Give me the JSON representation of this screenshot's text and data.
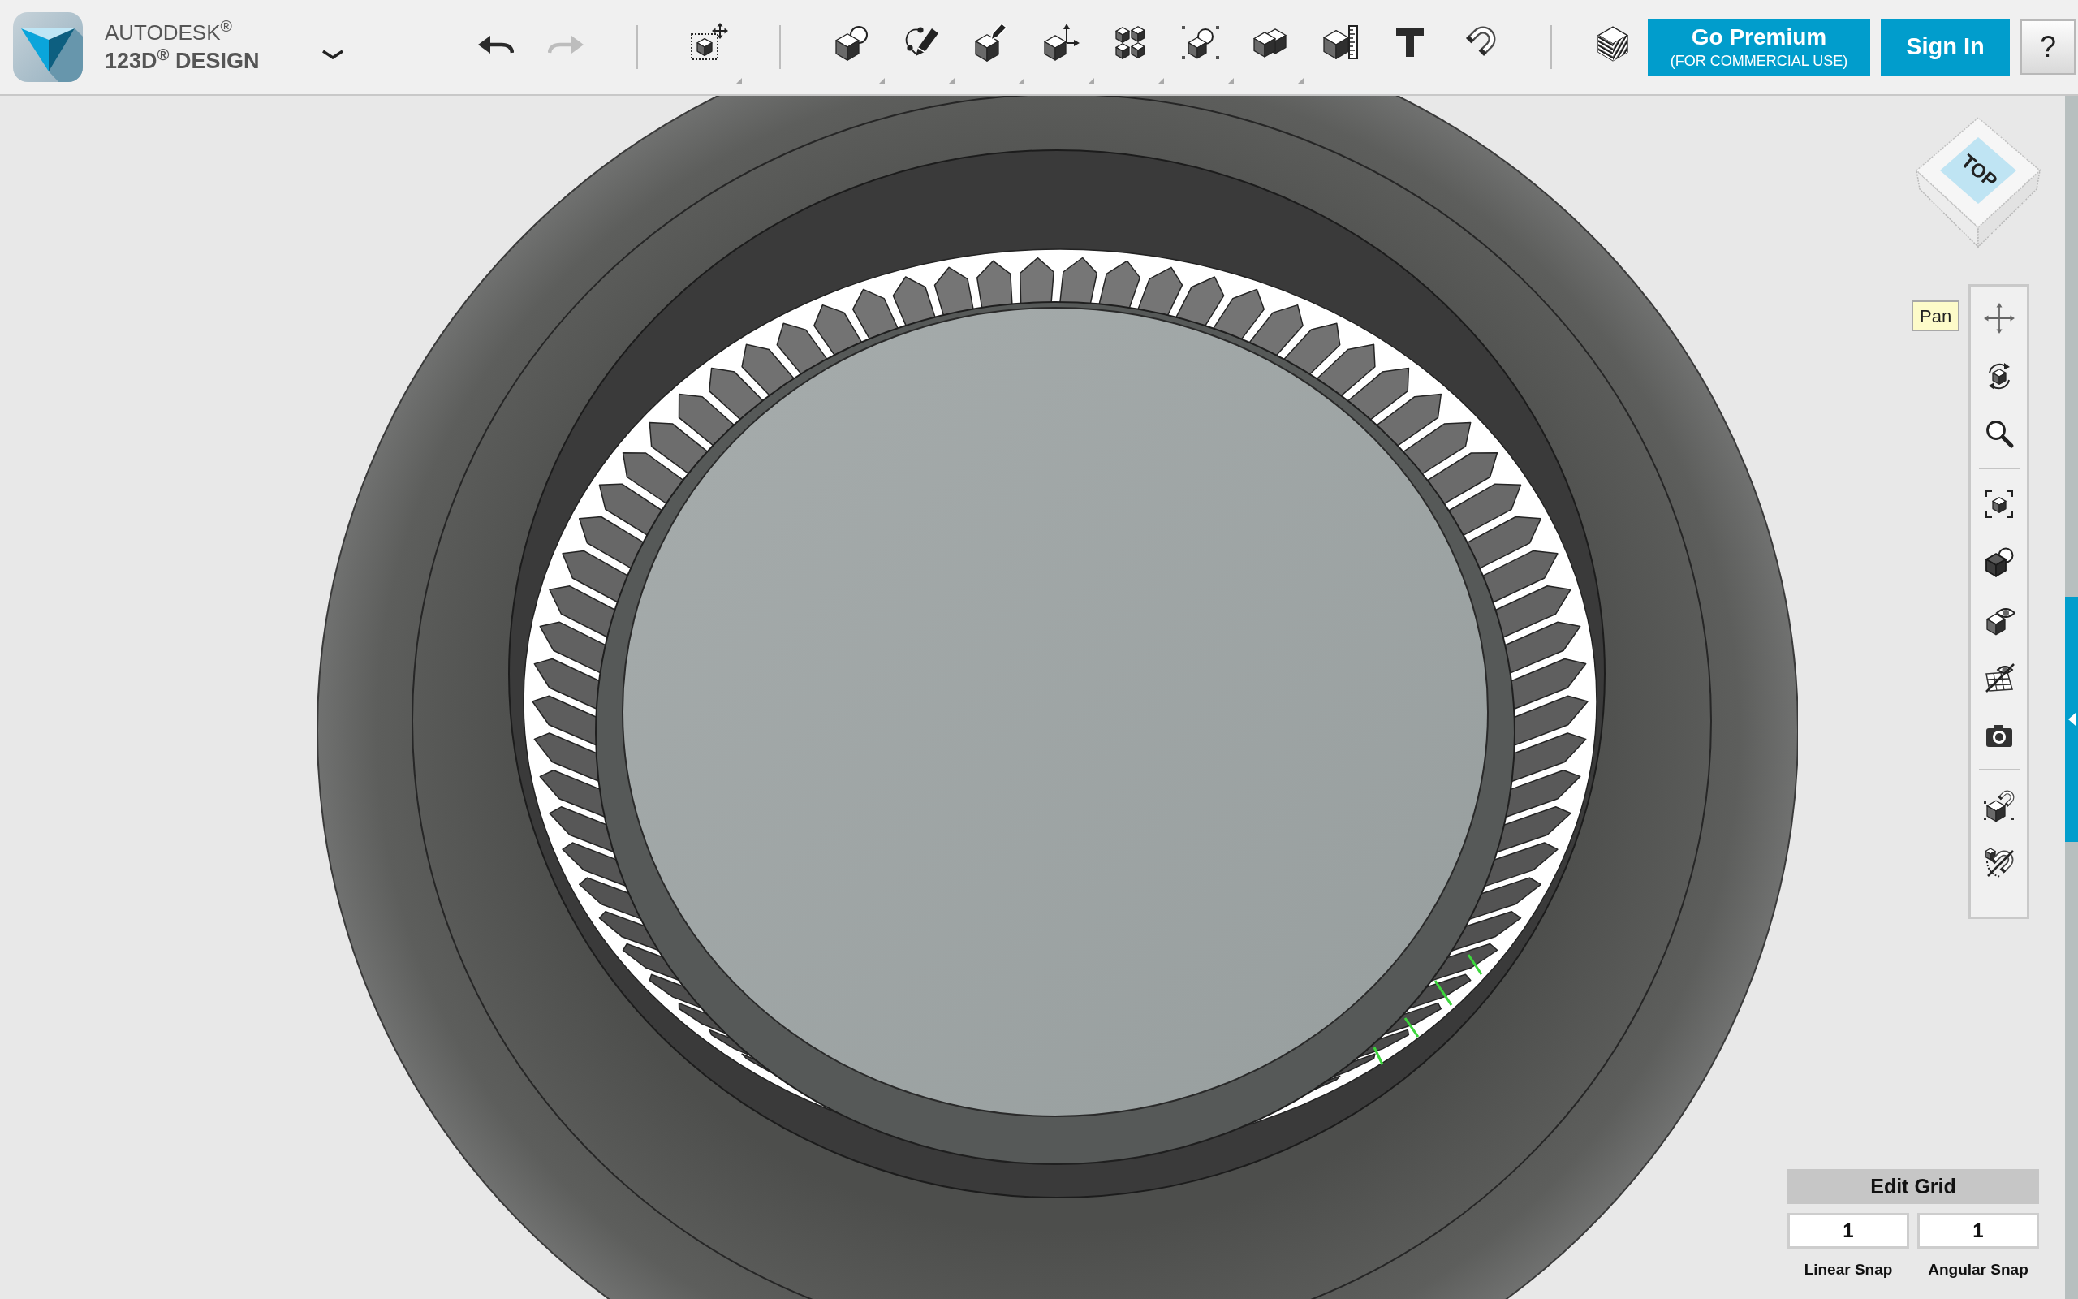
{
  "app_title": {
    "line_1": "AUTODESK$^{®}$",
    "line_2": "123D$^{®}$ DESIGN"
  },
  "history": [
    {
      "kind": "undo",
      "disabled": false
    },
    {
      "kind": "redo",
      "disabled": true
    }
  ],
  "tool_groups": [
    {
      "tools": [
        {
          "kind": "transform",
          "menu": true
        }
      ]
    },
    {
      "tools": [
        {
          "kind": "primitives",
          "menu": true
        },
        {
          "kind": "sketch",
          "menu": true
        },
        {
          "kind": "construct",
          "menu": true
        },
        {
          "kind": "modify",
          "menu": true
        },
        {
          "kind": "pattern",
          "menu": true
        },
        {
          "kind": "grouping",
          "menu": true
        },
        {
          "kind": "combine",
          "menu": true
        },
        {
          "kind": "measure",
          "menu": false
        },
        {
          "kind": "text",
          "menu": false
        },
        {
          "kind": "snap",
          "menu": false
        }
      ]
    },
    {
      "tools": [
        {
          "kind": "materials",
          "menu": false
        }
      ]
    }
  ],
  "premium_button": {
    "title": "Go Premium",
    "subtitle": "(FOR COMMERCIAL USE)"
  },
  "sign_in_button": {
    "label": "Sign In"
  },
  "help_button": {
    "label": "?"
  },
  "view_cube": {
    "face_label": "TOP"
  },
  "navigation_bar": {
    "tooltip": "Pan",
    "groups": [
      {
        "items": [
          {
            "kind": "pan"
          },
          {
            "kind": "orbit"
          },
          {
            "kind": "zoom"
          }
        ]
      },
      {
        "items": [
          {
            "kind": "fit"
          },
          {
            "kind": "solid"
          },
          {
            "kind": "visibility"
          },
          {
            "kind": "grid"
          },
          {
            "kind": "capture"
          }
        ]
      },
      {
        "items": [
          {
            "kind": "snap"
          },
          {
            "kind": "nosnap"
          }
        ]
      }
    ]
  },
  "edit_grid": {
    "title": "Edit Grid",
    "fields": [
      {
        "value": "1",
        "label": "Linear Snap"
      },
      {
        "value": "1",
        "label": "Angular Snap"
      }
    ]
  }
}
